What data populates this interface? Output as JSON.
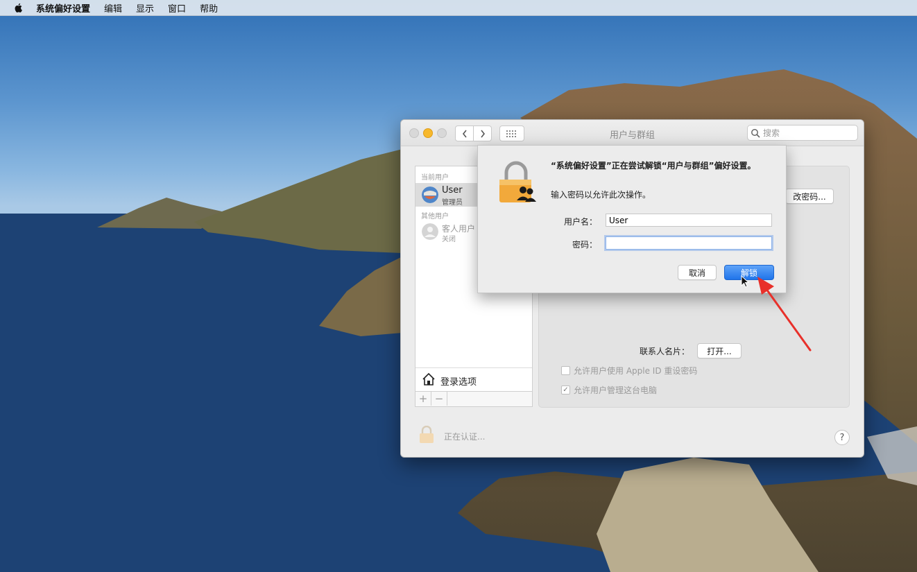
{
  "menubar": {
    "apple_icon": "apple-logo-icon",
    "app_name": "系统偏好设置",
    "items": [
      "编辑",
      "显示",
      "窗口",
      "帮助"
    ]
  },
  "window": {
    "title": "用户与群组",
    "search_placeholder": "搜索",
    "sidebar": {
      "current_users_label": "当前用户",
      "current_user": {
        "name": "User",
        "role": "管理员"
      },
      "other_users_label": "其他用户",
      "guest_user": {
        "name": "客人用户",
        "status": "关闭"
      },
      "login_options": "登录选项",
      "add_label": "+",
      "remove_label": "−"
    },
    "panel": {
      "change_password_button": "改密码...",
      "contact_card_label": "联系人名片：",
      "open_button": "打开...",
      "allow_reset_apple_id": "允许用户使用 Apple ID 重设密码",
      "allow_admin": "允许用户管理这台电脑",
      "allow_admin_checked": true,
      "allow_reset_checked": false
    },
    "status_text": "正在认证...",
    "help_label": "?"
  },
  "auth_dialog": {
    "message": "“系统偏好设置”正在尝试解锁“用户与群组”偏好设置。",
    "submessage": "输入密码以允许此次操作。",
    "username_label": "用户名：",
    "username_value": "User",
    "password_label": "密码：",
    "password_value": "",
    "cancel_button": "取消",
    "unlock_button": "解锁"
  },
  "colors": {
    "accent_blue": "#1f74ea",
    "arrow_red": "#e8302a",
    "lock_gold": "#f2a93b"
  }
}
